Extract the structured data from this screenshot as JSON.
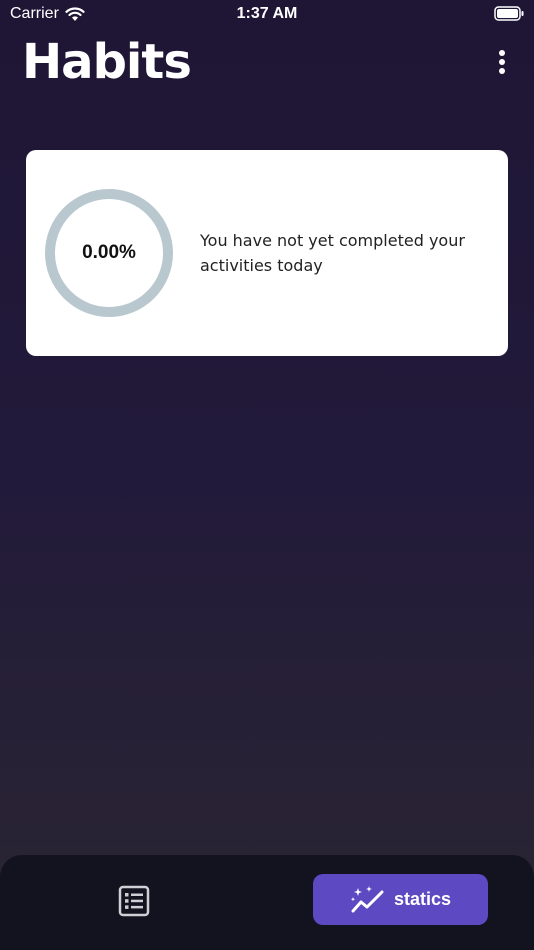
{
  "status_bar": {
    "carrier": "Carrier",
    "time": "1:37 AM"
  },
  "header": {
    "title": "Habits",
    "menu_icon": "more-vertical-icon"
  },
  "progress_card": {
    "percentage": "0.00%",
    "progress_fraction": 0,
    "message": "You have not yet completed your activities today",
    "ring_color": "#b9c8cf"
  },
  "bottom_nav": {
    "items": [
      {
        "icon": "list-icon",
        "label": ""
      },
      {
        "icon": "sparkle-chart-icon",
        "label": "statics"
      }
    ],
    "active_color": "#5d49c2"
  }
}
